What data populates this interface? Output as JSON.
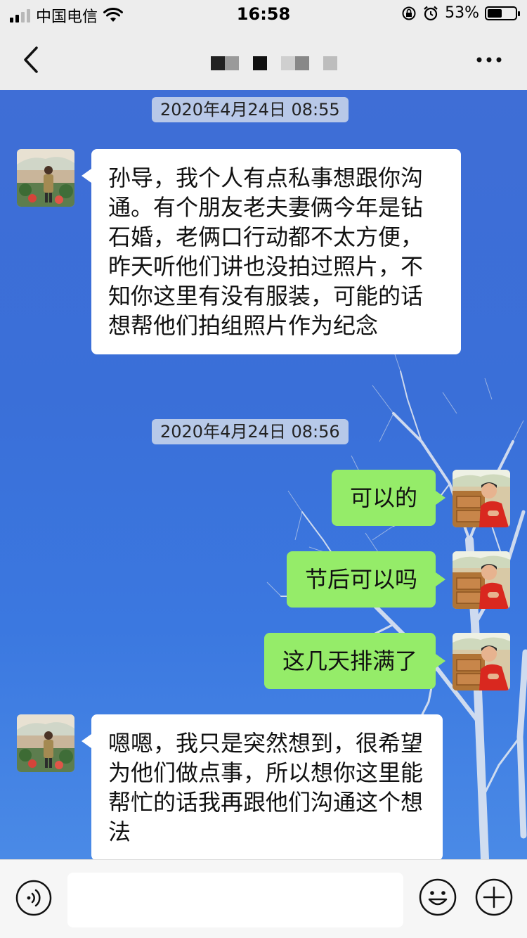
{
  "status_bar": {
    "carrier": "中国电信",
    "time": "16:58",
    "battery_percent_text": "53%",
    "battery_level": 0.53,
    "signal_bars_filled": 2,
    "signal_bars_total": 4
  },
  "nav": {
    "back_icon": "chevron-left-icon",
    "more_icon": "more-dots-icon",
    "title_mosaic_colors": [
      "#222222",
      "#9a9a9a",
      "#ededed",
      "#111111",
      "#ededed",
      "#cfcfcf",
      "#888888",
      "#ededed",
      "#bdbdbd"
    ]
  },
  "messages": [
    {
      "type": "timestamp",
      "text": "2020年4月24日 08:55"
    },
    {
      "type": "incoming",
      "text": "孙导，我个人有点私事想跟你沟通。有个朋友老夫妻俩今年是钻石婚，老俩口行动都不太方便，昨天听他们讲也没拍过照片，不知你这里有没有服装，可能的话想帮他们拍组照片作为纪念"
    },
    {
      "type": "timestamp",
      "text": "2020年4月24日 08:56"
    },
    {
      "type": "outgoing",
      "text": "可以的"
    },
    {
      "type": "outgoing",
      "text": "节后可以吗"
    },
    {
      "type": "outgoing",
      "text": "这几天排满了"
    },
    {
      "type": "incoming",
      "text": "嗯嗯，我只是突然想到，很希望为他们做点事，所以想你这里能帮忙的话我再跟他们沟通这个想法"
    }
  ],
  "input_bar": {
    "voice_icon": "voice-icon",
    "emoji_icon": "emoji-icon",
    "plus_icon": "plus-icon",
    "text_value": ""
  },
  "colors": {
    "outgoing_bubble": "#95ec69",
    "incoming_bubble": "#ffffff",
    "chat_background": "#3b72da",
    "bar_background": "#ededed"
  }
}
